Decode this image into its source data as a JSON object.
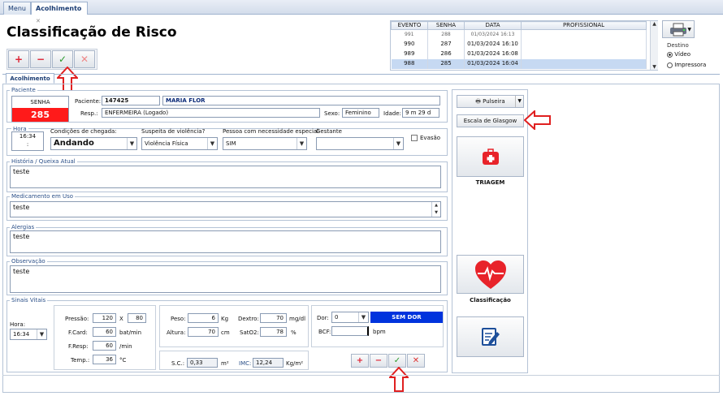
{
  "tabs": {
    "menu": "Menu",
    "acolhimento": "Acolhimento"
  },
  "header": {
    "title": "Classificação de Risco"
  },
  "toolbar": {
    "add": "+",
    "remove": "−",
    "confirm": "✓",
    "cancel": "✕"
  },
  "events": {
    "columns": [
      "EVENTO",
      "SENHA",
      "DATA",
      "PROFISSIONAL"
    ],
    "rows": [
      {
        "evento": "991",
        "senha": "288",
        "data": "01/03/2024 16:13",
        "prof": ""
      },
      {
        "evento": "990",
        "senha": "287",
        "data": "01/03/2024 16:10",
        "prof": ""
      },
      {
        "evento": "989",
        "senha": "286",
        "data": "01/03/2024 16:08",
        "prof": ""
      },
      {
        "evento": "988",
        "senha": "285",
        "data": "01/03/2024 16:04",
        "prof": ""
      }
    ]
  },
  "destino": {
    "label": "Destino",
    "options": [
      "Vídeo",
      "Impressora"
    ],
    "selected": "Vídeo"
  },
  "inner_tab": "Acolhimento",
  "paciente": {
    "legend": "Paciente",
    "senha_label": "SENHA",
    "senha_value": "285",
    "paciente_label": "Paciente:",
    "paciente_id": "147425",
    "paciente_nome": "MARIA FLOR",
    "resp_label": "Resp.:",
    "resp_value": "ENFERMEIRA (Logado)",
    "sexo_label": "Sexo:",
    "sexo_value": "Feminino",
    "idade_label": "Idade:",
    "idade_value": "9 m 29 d"
  },
  "chegada": {
    "hora_label": "Hora",
    "hora_value": "16:34",
    "hora_sub": ":",
    "condicoes_label": "Condições de chegada:",
    "condicoes_value": "Andando",
    "violencia_label": "Suspeita de violência?",
    "violencia_value": "Violência Física",
    "pne_label": "Pessoa com necessidade especial",
    "pne_value": "SIM",
    "gestante_label": "Gestante",
    "gestante_value": "",
    "evasao_label": "Evasão"
  },
  "historia": {
    "legend": "História / Queixa Atual",
    "value": "teste"
  },
  "medicamento": {
    "legend": "Medicamento em Uso",
    "value": "teste"
  },
  "alergias": {
    "legend": "Alergias",
    "value": "teste"
  },
  "observacao": {
    "legend": "Observação",
    "value": "teste"
  },
  "sinais": {
    "legend": "Sinais Vitais",
    "hora_label": "Hora:",
    "hora_value": "16:34",
    "pressao_label": "Pressão:",
    "pressao_sis": "120",
    "pressao_x": "X",
    "pressao_dia": "80",
    "fcard_label": "F.Card:",
    "fcard_value": "60",
    "fcard_unit": "bat/min",
    "fresp_label": "F.Resp:",
    "fresp_value": "60",
    "fresp_unit": "/min",
    "temp_label": "Temp.:",
    "temp_value": "36",
    "temp_unit": "°C",
    "peso_label": "Peso:",
    "peso_value": "6",
    "peso_unit": "Kg",
    "altura_label": "Altura:",
    "altura_value": "70",
    "altura_unit": "cm",
    "dextro_label": "Dextro:",
    "dextro_value": "70",
    "dextro_unit": "mg/dl",
    "sato2_label": "SatO2:",
    "sato2_value": "78",
    "sato2_unit": "%",
    "sc_label": "S.C.:",
    "sc_value": "0,33",
    "sc_unit": "m²",
    "imc_label": "IMC:",
    "imc_value": "12,24",
    "imc_unit": "Kg/m²",
    "dor_label": "Dor:",
    "dor_value": "0",
    "dor_badge": "SEM DOR",
    "bcf_label": "BCF:",
    "bcf_value": "",
    "bcf_unit": "bpm"
  },
  "side": {
    "pulseira": "Pulseira",
    "glasgow": "Escala de Glasgow",
    "triagem": "TRIAGEM",
    "classificacao": "Classificação"
  },
  "colors": {
    "senha_red": "#ff1a1a",
    "dor_blue": "#0033dd",
    "accent": "#1b3d74"
  }
}
